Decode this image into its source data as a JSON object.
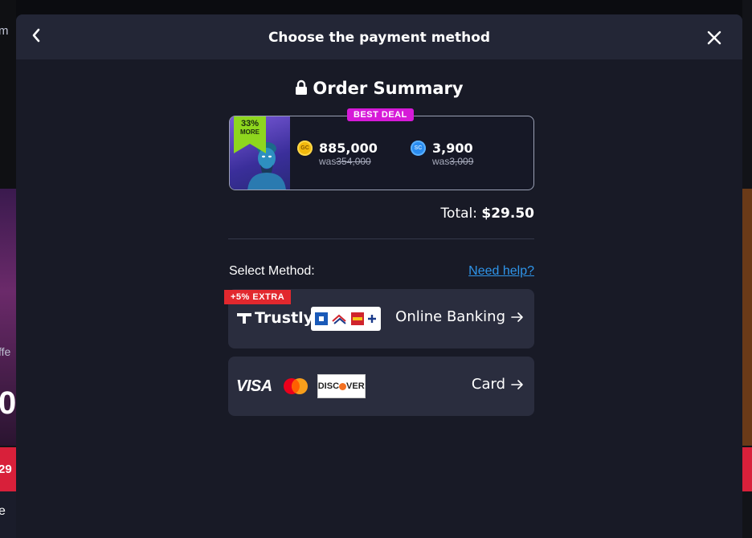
{
  "background": {
    "text_fragments": [
      "m",
      "ffe",
      "0",
      "29",
      "e"
    ]
  },
  "modal": {
    "title": "Choose the payment method",
    "back_icon": "chevron-left-icon",
    "close_icon": "close-icon"
  },
  "order_summary": {
    "title": "Order Summary",
    "badge": "BEST DEAL",
    "ribbon_percent": "33%",
    "ribbon_text": "MORE",
    "gold_coins": {
      "icon_label": "GC",
      "amount": "885,000",
      "was_prefix": "was",
      "was_value": "354,000"
    },
    "sweeps_coins": {
      "icon_label": "SC",
      "amount": "3,900",
      "was_prefix": "was",
      "was_value": "3,009"
    },
    "total_label": "Total:",
    "total_value": "$29.50"
  },
  "methods": {
    "section_label": "Select Method:",
    "help_link": "Need help?",
    "online_banking": {
      "badge": "+5% EXTRA",
      "provider": "Trustly",
      "label": "Online Banking"
    },
    "card": {
      "visa": "VISA",
      "discover_left": "DISC",
      "discover_right": "VER",
      "label": "Card"
    }
  },
  "colors": {
    "modal_bg": "#181a26",
    "header_bg": "#232636",
    "method_bg": "#2a2d3e",
    "best_deal": "#d61ad8",
    "extra_badge": "#e2282e",
    "link": "#2f95ea"
  }
}
